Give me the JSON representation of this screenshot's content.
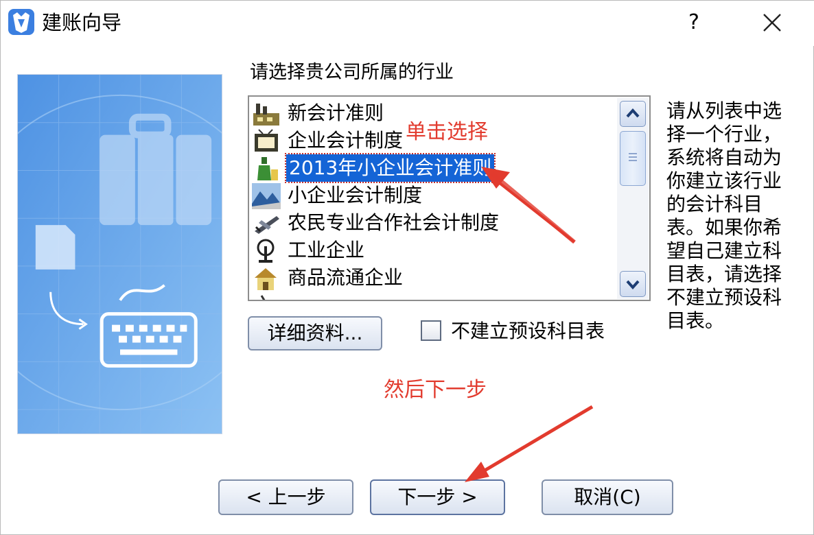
{
  "window": {
    "title": "建账向导",
    "help_label": "?",
    "close_icon": "close-icon"
  },
  "main": {
    "heading": "请选择贵公司所属的行业",
    "industries": [
      {
        "label": "新会计准则",
        "icon": "factory-icon",
        "selected": false
      },
      {
        "label": "企业会计制度",
        "icon": "monitor-icon",
        "selected": false
      },
      {
        "label": "2013年小企业会计准则",
        "icon": "bottle-icon",
        "selected": true
      },
      {
        "label": "小企业会计制度",
        "icon": "landscape-icon",
        "selected": false
      },
      {
        "label": "农民专业合作社会计制度",
        "icon": "plane-icon",
        "selected": false
      },
      {
        "label": "工业企业",
        "icon": "crane-icon",
        "selected": false
      },
      {
        "label": "商品流通企业",
        "icon": "house-icon",
        "selected": false
      }
    ],
    "help_text": "请从列表中选择一个行业，系统将自动为你建立该行业的会计科目表。如果你希望自己建立科目表，请选择不建立预设科目表。",
    "details_button": "详细资料...",
    "no_preset_checkbox": {
      "label": "不建立预设科目表",
      "checked": false
    }
  },
  "footer": {
    "prev_button": "< 上一步",
    "next_button": "下一步 >",
    "cancel_button": "取消(C)"
  },
  "annotations": {
    "click_select": "单击选择",
    "then_next": "然后下一步"
  },
  "colors": {
    "selection": "#1464d6",
    "annotation": "#e23b2e",
    "panel_blue": "#6fa8ea"
  }
}
